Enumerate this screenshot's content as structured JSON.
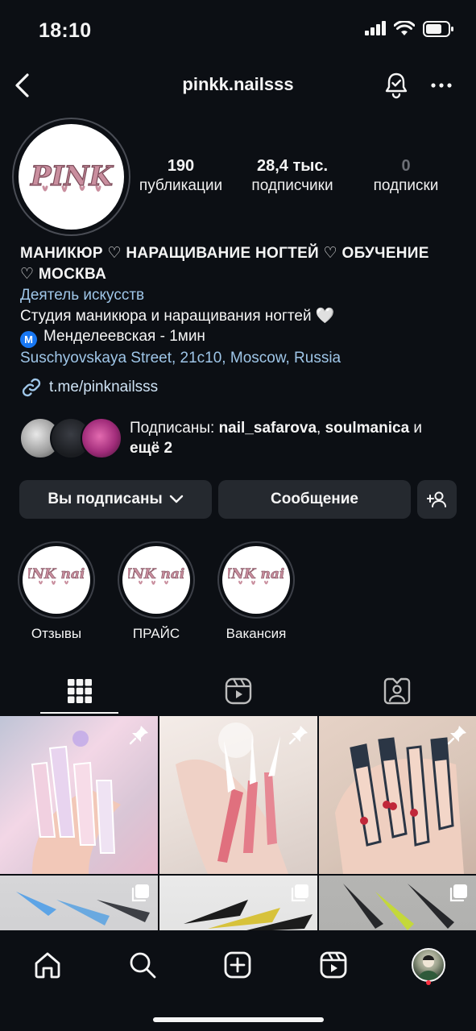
{
  "status_bar": {
    "time": "18:10"
  },
  "nav": {
    "username": "pinkk.nailsss"
  },
  "profile": {
    "avatar_logo_text": "PINK",
    "stats": [
      {
        "value": "190",
        "label": "публикации"
      },
      {
        "value": "28,4 тыс.",
        "label": "подписчики"
      },
      {
        "value": "0",
        "label": "подписки"
      }
    ]
  },
  "bio": {
    "title_line1": "МАНИКЮР ♡ НАРАЩИВАНИЕ НОГТЕЙ  ♡ ОБУЧЕНИЕ",
    "title_line2": "♡ МОСКВА",
    "category": "Деятель искусств",
    "description": "Студия маникюра и наращивания ногтей 🤍",
    "metro_badge": "M",
    "metro": "Менделеевская - 1мин",
    "location": "Suschyovskaya Street, 21с10, Moscow, Russia",
    "link": "t.me/pinknailsss"
  },
  "followed_by": {
    "prefix": "Подписаны: ",
    "user1": "nail_safarova",
    "separator": ", ",
    "user2": "soulmanica",
    "middle": " и",
    "suffix": "ещё 2"
  },
  "actions": {
    "following_label": "Вы подписаны",
    "message_label": "Сообщение"
  },
  "highlights": [
    {
      "label": "Отзывы",
      "logo": "PINK nails"
    },
    {
      "label": "ПРАЙС",
      "logo": "PINK nails"
    },
    {
      "label": "Вакансия",
      "logo": "PINK nails"
    }
  ],
  "tabs": [
    "posts-grid-icon",
    "reels-icon",
    "tagged-icon"
  ],
  "grid": [
    {
      "type": "pinned",
      "palette": [
        "#d9c6d6",
        "#f3d7e6",
        "#bfc4d6"
      ]
    },
    {
      "type": "pinned",
      "palette": [
        "#e9dfd9",
        "#f4ece8",
        "#e07a86"
      ]
    },
    {
      "type": "pinned",
      "palette": [
        "#d8c5b8",
        "#efcfc0",
        "#2b3645"
      ]
    },
    {
      "type": "carousel",
      "palette": [
        "#c9c9cb",
        "#6aa9e0",
        "#3d3f45"
      ]
    },
    {
      "type": "carousel",
      "palette": [
        "#d7d7d6",
        "#eaeaea",
        "#1c1c1c"
      ]
    },
    {
      "type": "carousel",
      "palette": [
        "#a9a9a7",
        "#c4d83a",
        "#26272a"
      ]
    }
  ],
  "colors": {
    "background": "#0c0f14",
    "button": "#25292f",
    "link_blue": "#9fc6e8",
    "logo_pink": "#c98e9e",
    "notification_dot": "#ff3040"
  }
}
